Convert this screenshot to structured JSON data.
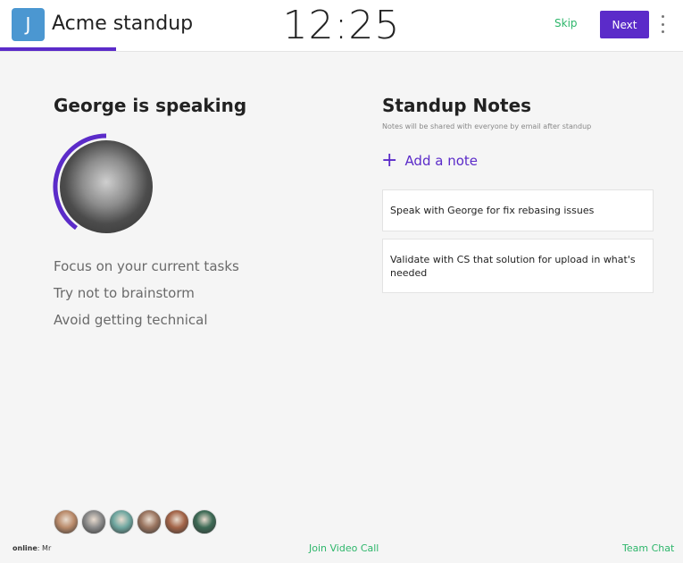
{
  "header": {
    "app_initial": "J",
    "app_title": "Acme standup",
    "timer": "12:25",
    "skip_label": "Skip",
    "next_label": "Next",
    "menu_icon": "kebab-menu-icon",
    "meeting_progress": 0.17
  },
  "speaker": {
    "title": "George is speaking",
    "time_progress": 0.4,
    "tips": [
      "Focus on your current tasks",
      "Try not to brainstorm",
      "Avoid getting technical"
    ]
  },
  "notes": {
    "title": "Standup Notes",
    "subtitle": "Notes will be shared with everyone by email after standup",
    "add_label": "Add a note",
    "items": [
      "Speak with George for fix rebasing issues",
      "Validate with CS that solution for upload in what's needed"
    ]
  },
  "footer": {
    "online_label": "online",
    "online_names": ": Mr",
    "join_call_label": "Join Video Call",
    "team_chat_label": "Team Chat"
  },
  "attendees": [
    {
      "tone": "#b98a6a"
    },
    {
      "tone": "#8a8a8a"
    },
    {
      "tone": "#6fa7a0"
    },
    {
      "tone": "#9a7560"
    },
    {
      "tone": "#a36448"
    },
    {
      "tone": "#3d6a55"
    }
  ],
  "colors": {
    "accent": "#5b2bc9",
    "green": "#2eb66b",
    "app_icon_bg": "#4b97d1"
  }
}
